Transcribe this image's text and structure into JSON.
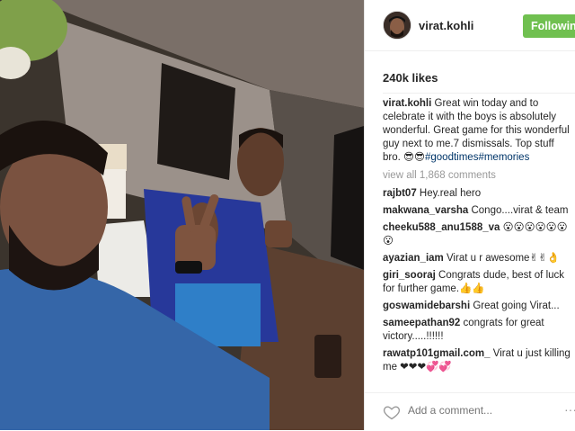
{
  "post": {
    "author": "virat.kohli",
    "follow_label": "Following",
    "likes": "240k likes",
    "caption": {
      "user": "virat.kohli",
      "text": "Great win today and to celebrate it with the boys is absolutely wonderful. Great game for this wonderful guy next to me.7 dismissals. Top stuff bro. 😎😎",
      "hashtags": "#goodtimes#memories"
    },
    "view_all": "view all 1,868 comments",
    "comments": [
      {
        "user": "rajbt07",
        "text": "Hey.real hero"
      },
      {
        "user": "makwana_varsha",
        "text": "Congo....virat & team"
      },
      {
        "user": "cheeku588_anu1588_va",
        "text": "😮😮😮😮😮😮😮"
      },
      {
        "user": "ayazian_iam",
        "text": "Virat u r awesome✌✌👌"
      },
      {
        "user": "giri_sooraj",
        "text": "Congrats dude, best of luck for further game.👍👍"
      },
      {
        "user": "goswamidebarshi",
        "text": "Great going Virat..."
      },
      {
        "user": "sameepathan92",
        "text": "congrats for great victory.....!!!!!!"
      },
      {
        "user": "rawatp101gmail.com_",
        "text": "Virat u just killing me ❤❤❤💞💞"
      }
    ],
    "add_comment_placeholder": "Add a comment...",
    "more_options": "···"
  }
}
